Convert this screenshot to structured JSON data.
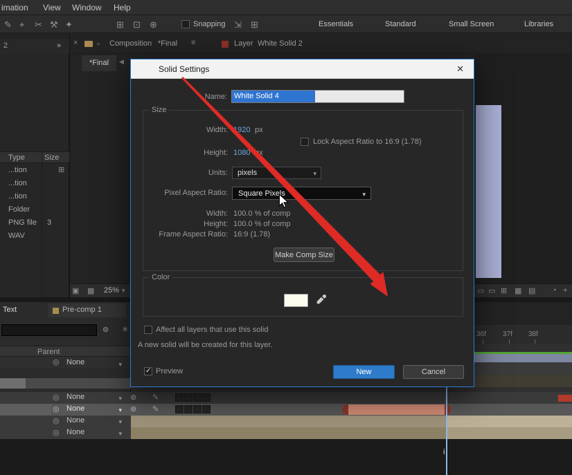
{
  "icons": {
    "close_tab": "×",
    "close_dialog": "✕",
    "menu": "≡",
    "chevron_down": "▾",
    "check": "✓",
    "chevrons_right": "»",
    "back_arrow": "◀",
    "pick_whip": "◎",
    "pen": "✎",
    "whip2": "⊚"
  },
  "menubar": {
    "items": [
      "imation",
      "View",
      "Window",
      "Help"
    ]
  },
  "toolbar": {
    "tool_icons": [
      "✎",
      "⌖",
      "✂",
      "⚒",
      "✦",
      "⊞",
      "⊡",
      "⊕"
    ],
    "snapping_label": "Snapping",
    "snap_icons": [
      "⇲",
      "⊞"
    ],
    "workspaces": [
      "Essentials",
      "Standard",
      "Small Screen",
      "Libraries"
    ]
  },
  "viewer_tabs": {
    "panel_badge": "2",
    "composition_label": "Composition",
    "composition_name": "*Final",
    "layer_label": "Layer",
    "layer_name": "White Solid 2",
    "final_tab": "*Final"
  },
  "project": {
    "col_type": "Type",
    "col_size": "Size",
    "rows": [
      {
        "type": "...tion",
        "size": ""
      },
      {
        "type": "...tion",
        "size": ""
      },
      {
        "type": "...tion",
        "size": ""
      },
      {
        "type": "Folder",
        "size": ""
      },
      {
        "type": "PNG file",
        "size": "3"
      },
      {
        "type": "WAV",
        "size": ""
      }
    ],
    "zoom": "25%"
  },
  "timeline": {
    "text_label": "Text",
    "precomp_tab": "Pre-comp 1",
    "parent_header": "Parent",
    "parent_rows": [
      "None",
      "None",
      "None",
      "None",
      "None"
    ],
    "ruler": [
      "36f",
      "37f",
      "38f"
    ],
    "playhead_label": "i"
  },
  "dialog": {
    "title": "Solid Settings",
    "name_label": "Name:",
    "name_value": "White Solid 4",
    "size": {
      "group_label": "Size",
      "width_label": "Width:",
      "width_value": "1920",
      "width_unit": "px",
      "lock_aspect": "Lock Aspect Ratio to 16:9 (1.78)",
      "height_label": "Height:",
      "height_value": "1080",
      "height_unit": "px",
      "units_label": "Units:",
      "units_value": "pixels",
      "par_label": "Pixel Aspect Ratio:",
      "par_value": "Square Pixels",
      "width_pct_label": "Width:",
      "width_pct_value": "100.0 % of comp",
      "height_pct_label": "Height:",
      "height_pct_value": "100.0 % of comp",
      "frame_label": "Frame Aspect Ratio:",
      "frame_value": "16:9 (1.78)",
      "make_comp": "Make Comp Size"
    },
    "color": {
      "group_label": "Color"
    },
    "affect_label": "Affect all layers that use this solid",
    "note": "A new solid will be created for this layer.",
    "preview_label": "Preview",
    "new_button": "New",
    "cancel_button": "Cancel"
  }
}
